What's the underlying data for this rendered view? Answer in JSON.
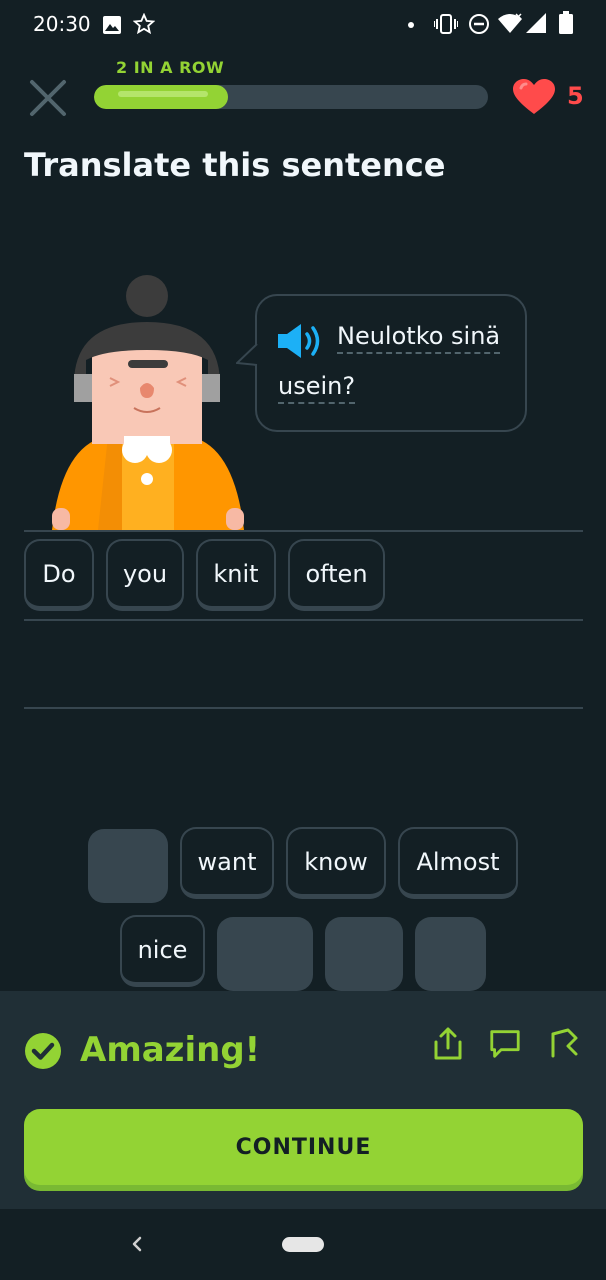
{
  "status_bar": {
    "time": "20:30",
    "icons": [
      "image-icon",
      "star-icon",
      "dot-icon",
      "vibrate-icon",
      "dnd-icon",
      "wifi-icon",
      "signal-icon",
      "battery-icon"
    ]
  },
  "header": {
    "streak_label": "2 IN A ROW",
    "progress_fraction": 0.34,
    "hearts": "5"
  },
  "title": "Translate this sentence",
  "prompt": {
    "words_line1": "Neulotko sinä",
    "words_line2": "usein?"
  },
  "answer_words": [
    "Do",
    "you",
    "knit",
    "often"
  ],
  "word_bank": {
    "row1": [
      {
        "label": "",
        "used": true
      },
      {
        "label": "want",
        "used": false
      },
      {
        "label": "know",
        "used": false
      },
      {
        "label": "Almost",
        "used": false
      }
    ],
    "row2": [
      {
        "label": "nice",
        "used": false
      },
      {
        "label": "",
        "used": true
      },
      {
        "label": "",
        "used": true
      },
      {
        "label": "",
        "used": true
      }
    ]
  },
  "feedback": {
    "title": "Amazing!",
    "continue_label": "CONTINUE"
  },
  "colors": {
    "background": "#131f24",
    "accent_green": "#93d334",
    "heart_red": "#ff4b4b",
    "chip_border": "#37464f",
    "speaker_blue": "#1cb0f6"
  }
}
